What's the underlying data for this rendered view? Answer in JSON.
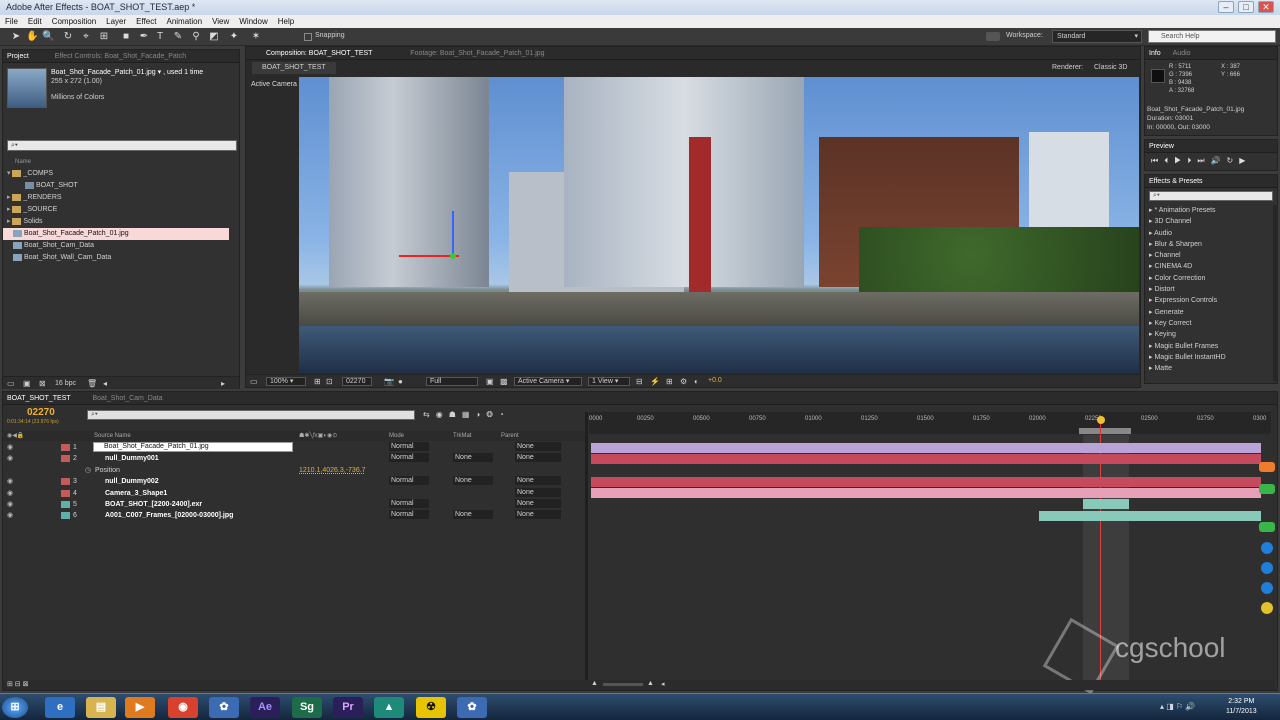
{
  "window": {
    "title": "Adobe After Effects - BOAT_SHOT_TEST.aep *"
  },
  "menu": [
    "File",
    "Edit",
    "Composition",
    "Layer",
    "Effect",
    "Animation",
    "View",
    "Window",
    "Help"
  ],
  "toolbar": {
    "snapping_label": "Snapping",
    "workspace_label": "Workspace:",
    "workspace_value": "Standard",
    "search_placeholder": "Search Help"
  },
  "project_panel": {
    "tab_project": "Project",
    "tab_effect_controls": "Effect Controls: Boat_Shot_Facade_Patch",
    "selected_name": "Boat_Shot_Facade_Patch_01.jpg ▾ , used 1 time",
    "selected_dims": "255 x 272 (1.00)",
    "selected_colors": "Millions of Colors",
    "name_header": "Name",
    "items": [
      {
        "label": "_COMPS",
        "kind": "folder"
      },
      {
        "label": "BOAT_SHOT",
        "kind": "comp"
      },
      {
        "label": "_RENDERS",
        "kind": "folder"
      },
      {
        "label": "_SOURCE",
        "kind": "folder"
      },
      {
        "label": "Solids",
        "kind": "folder"
      },
      {
        "label": "Boat_Shot_Facade_Patch_01.jpg",
        "kind": "footage"
      },
      {
        "label": "Boat_Shot_Cam_Data",
        "kind": "footage"
      },
      {
        "label": "Boat_Shot_Wall_Cam_Data",
        "kind": "footage"
      }
    ],
    "bpc": "16 bpc"
  },
  "comp_panel": {
    "tab_comp": "Composition: BOAT_SHOT_TEST",
    "tab_footage": "Footage: Boat_Shot_Facade_Patch_01.jpg",
    "breadcrumb": "BOAT_SHOT_TEST",
    "renderer": "Renderer:",
    "renderer_value": "Classic 3D",
    "camera_label": "Active Camera",
    "zoom": "100%",
    "timecode": "02270",
    "resolution": "Full",
    "view_camera": "Active Camera",
    "views": "1 View",
    "exposure": "+0.0"
  },
  "info_panel": {
    "tab_info": "Info",
    "tab_audio": "Audio",
    "r": "R : 5711",
    "g": "G : 7396",
    "b": "B : 9438",
    "a": "A : 32768",
    "x": "X : 387",
    "y": "Y : 666",
    "file": "Boat_Shot_Facade_Patch_01.jpg",
    "duration": "Duration: 03001",
    "in_out": "In: 00000, Out: 03000"
  },
  "preview_panel": {
    "tab": "Preview"
  },
  "effects_panel": {
    "tab": "Effects & Presets",
    "items": [
      "* Animation Presets",
      "3D Channel",
      "Audio",
      "Blur & Sharpen",
      "Channel",
      "CINEMA 4D",
      "Color Correction",
      "Distort",
      "Expression Controls",
      "Generate",
      "Key Correct",
      "Keying",
      "Magic Bullet Frames",
      "Magic Bullet InstantHD",
      "Matte"
    ]
  },
  "timeline": {
    "tab_active": "BOAT_SHOT_TEST",
    "tab_other": "Boat_Shot_Cam_Data",
    "timecode": "02270",
    "timecode_sub": "0:01:34:14 (23.976 fps)",
    "col_source": "Source Name",
    "col_mode": "Mode",
    "col_trkmat": "TrkMat",
    "col_parent": "Parent",
    "ruler": [
      "0000",
      "00250",
      "00500",
      "00750",
      "01000",
      "01250",
      "01500",
      "01750",
      "02000",
      "02250",
      "02500",
      "02750",
      "0300"
    ],
    "layers": [
      {
        "num": "1",
        "name": "Boat_Shot_Facade_Patch_01.jpg",
        "mode": "Normal",
        "trkmat": "",
        "parent": "None",
        "color": "#c45a5a"
      },
      {
        "num": "2",
        "name": "null_Dummy001",
        "mode": "Normal",
        "trkmat": "None",
        "parent": "None",
        "color": "#c45a5a"
      },
      {
        "num": "3",
        "name": "null_Dummy002",
        "mode": "Normal",
        "trkmat": "None",
        "parent": "None",
        "color": "#c45a5a"
      },
      {
        "num": "4",
        "name": "Camera_3_Shape1",
        "mode": "",
        "trkmat": "",
        "parent": "None",
        "color": "#c45a5a"
      },
      {
        "num": "5",
        "name": "BOAT_SHOT_[2200-2400].exr",
        "mode": "Normal",
        "trkmat": "",
        "parent": "None",
        "color": "#5fb1a8"
      },
      {
        "num": "6",
        "name": "A001_C007_Frames_[02000-03000].jpg",
        "mode": "Normal",
        "trkmat": "None",
        "parent": "None",
        "color": "#5fb1a8"
      }
    ],
    "position_label": "Position",
    "position_value": "1210.1,4026.3,-736.7"
  },
  "watermark": "cgschool",
  "taskbar": {
    "time": "2:32 PM",
    "date": "11/7/2013"
  }
}
